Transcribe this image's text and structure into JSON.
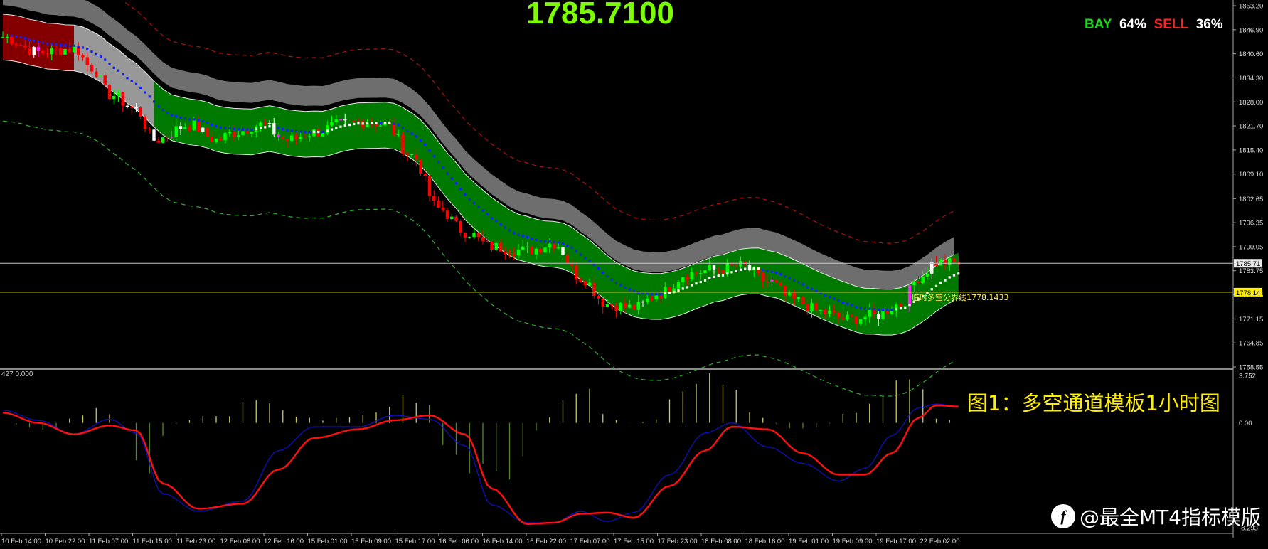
{
  "header": {
    "price": "1785.7100",
    "buy_label": "BAY",
    "buy_pct": "64%",
    "sell_label": "SELL",
    "sell_pct": "36%"
  },
  "caption": "图1：多空通道模板1小时图",
  "watermark": "@最全MT4指标模版",
  "watermark_logo": "f",
  "indicator_label": "427 0.000",
  "boundary_label": "临时多空分界线1778.1433",
  "price_tags": {
    "current": "1785.71",
    "boundary": "1778.14"
  },
  "colors": {
    "bull_candle": "#00ff00",
    "bear_candle": "#ff0000",
    "channel_fill": "#008000",
    "grey_band": "#7a7a7a",
    "dot_line_down": "#1020ff",
    "dot_line_up": "#ffffff",
    "macd_red": "#ff1010",
    "macd_blue": "#1010cc",
    "hist": "#c8c864"
  },
  "chart_data": [
    {
      "type": "candlestick",
      "ylim": [
        1758.55,
        1853.2
      ],
      "y_ticks": [
        "1853.20",
        "1846.90",
        "1840.60",
        "1834.30",
        "1828.00",
        "1821.70",
        "1815.40",
        "1809.10",
        "1802.65",
        "1796.35",
        "1790.05",
        "1783.75",
        "1777.45",
        "1771.15",
        "1764.85",
        "1758.55"
      ],
      "x_ticks": [
        "10 Feb 14:00",
        "10 Feb 22:00",
        "11 Feb 07:00",
        "11 Feb 15:00",
        "11 Feb 23:00",
        "12 Feb 08:00",
        "12 Feb 16:00",
        "15 Feb 01:00",
        "15 Feb 09:00",
        "15 Feb 17:00",
        "16 Feb 06:00",
        "16 Feb 14:00",
        "16 Feb 22:00",
        "17 Feb 07:00",
        "17 Feb 15:00",
        "17 Feb 23:00",
        "18 Feb 08:00",
        "18 Feb 16:00",
        "19 Feb 01:00",
        "19 Feb 09:00",
        "19 Feb 17:00",
        "22 Feb 02:00"
      ],
      "close_anchors": [
        [
          0,
          1845
        ],
        [
          8,
          1841
        ],
        [
          16,
          1842
        ],
        [
          20,
          1837
        ],
        [
          24,
          1830
        ],
        [
          30,
          1826
        ],
        [
          34,
          1818
        ],
        [
          42,
          1822
        ],
        [
          48,
          1818
        ],
        [
          52,
          1820
        ],
        [
          58,
          1822
        ],
        [
          64,
          1818
        ],
        [
          70,
          1820
        ],
        [
          76,
          1822
        ],
        [
          82,
          1823
        ],
        [
          86,
          1822
        ],
        [
          92,
          1814
        ],
        [
          98,
          1800
        ],
        [
          104,
          1794
        ],
        [
          110,
          1790
        ],
        [
          118,
          1789
        ],
        [
          124,
          1791
        ],
        [
          130,
          1782
        ],
        [
          136,
          1775
        ],
        [
          142,
          1774
        ],
        [
          148,
          1778
        ],
        [
          154,
          1783
        ],
        [
          160,
          1784
        ],
        [
          166,
          1785
        ],
        [
          172,
          1781
        ],
        [
          178,
          1776
        ],
        [
          184,
          1773
        ],
        [
          190,
          1771
        ],
        [
          196,
          1772
        ],
        [
          202,
          1775
        ],
        [
          206,
          1782
        ],
        [
          210,
          1786
        ],
        [
          215,
          1785.7
        ]
      ],
      "horizontal_lines": [
        {
          "name": "current-price",
          "value": 1785.71
        },
        {
          "name": "temporary-boundary",
          "value": 1778.14
        }
      ]
    },
    {
      "type": "line",
      "ylim": [
        -8.293,
        3.752
      ],
      "y_ticks": [
        "3.752",
        "0.00",
        "-8.293"
      ],
      "series": [
        {
          "anchors": [
            [
              0,
              0.8
            ],
            [
              8,
              0.0
            ],
            [
              16,
              -0.9
            ],
            [
              24,
              -0.2
            ],
            [
              30,
              -0.6
            ],
            [
              36,
              -4.8
            ],
            [
              44,
              -6.8
            ],
            [
              54,
              -6.4
            ],
            [
              62,
              -3.7
            ],
            [
              70,
              -1.2
            ],
            [
              80,
              -0.5
            ],
            [
              88,
              0.2
            ],
            [
              96,
              0.6
            ],
            [
              104,
              -0.9
            ],
            [
              110,
              -5.2
            ],
            [
              118,
              -8.0
            ],
            [
              124,
              -7.9
            ],
            [
              130,
              -7.2
            ],
            [
              136,
              -7.1
            ],
            [
              142,
              -7.5
            ],
            [
              150,
              -5.0
            ],
            [
              158,
              -2.2
            ],
            [
              164,
              -0.3
            ],
            [
              172,
              -0.5
            ],
            [
              180,
              -2.4
            ],
            [
              188,
              -4.1
            ],
            [
              194,
              -4.1
            ],
            [
              200,
              -2.4
            ],
            [
              206,
              0.4
            ],
            [
              210,
              1.4
            ],
            [
              215,
              1.3
            ]
          ]
        },
        {
          "anchors": [
            [
              0,
              1.0
            ],
            [
              8,
              0.2
            ],
            [
              16,
              -0.9
            ],
            [
              24,
              0.3
            ],
            [
              30,
              -0.8
            ],
            [
              36,
              -5.6
            ],
            [
              44,
              -7.0
            ],
            [
              54,
              -6.2
            ],
            [
              62,
              -2.2
            ],
            [
              70,
              -0.3
            ],
            [
              80,
              -0.3
            ],
            [
              88,
              0.6
            ],
            [
              96,
              0.3
            ],
            [
              104,
              -1.8
            ],
            [
              110,
              -6.5
            ],
            [
              118,
              -7.9
            ],
            [
              124,
              -7.9
            ],
            [
              130,
              -7.0
            ],
            [
              136,
              -7.8
            ],
            [
              142,
              -7.1
            ],
            [
              150,
              -4.1
            ],
            [
              158,
              -0.8
            ],
            [
              164,
              0.0
            ],
            [
              172,
              -1.9
            ],
            [
              180,
              -3.2
            ],
            [
              188,
              -4.6
            ],
            [
              194,
              -3.6
            ],
            [
              200,
              -1.0
            ],
            [
              206,
              1.2
            ],
            [
              210,
              1.5
            ],
            [
              215,
              1.3
            ]
          ]
        }
      ],
      "histogram_anchors": [
        [
          0,
          0
        ],
        [
          10,
          -0.6
        ],
        [
          16,
          0.4
        ],
        [
          22,
          1.1
        ],
        [
          26,
          0.3
        ],
        [
          32,
          -4.6
        ],
        [
          36,
          -1.2
        ],
        [
          40,
          0.1
        ],
        [
          46,
          0.5
        ],
        [
          50,
          0.5
        ],
        [
          56,
          2.1
        ],
        [
          60,
          1.5
        ],
        [
          68,
          0.4
        ],
        [
          72,
          0.2
        ],
        [
          78,
          0.5
        ],
        [
          84,
          0.9
        ],
        [
          90,
          2.1
        ],
        [
          96,
          1.3
        ],
        [
          100,
          -2.1
        ],
        [
          106,
          -3.6
        ],
        [
          114,
          -4.0
        ],
        [
          120,
          -0.6
        ],
        [
          126,
          1.6
        ],
        [
          132,
          2.5
        ],
        [
          136,
          0.5
        ],
        [
          140,
          0
        ],
        [
          146,
          0.1
        ],
        [
          152,
          2.3
        ],
        [
          158,
          3.7
        ],
        [
          164,
          2.6
        ],
        [
          170,
          0.4
        ],
        [
          178,
          -0.5
        ],
        [
          184,
          -0.3
        ],
        [
          190,
          0.7
        ],
        [
          196,
          1.4
        ],
        [
          202,
          3.6
        ],
        [
          206,
          3.2
        ],
        [
          210,
          0.3
        ],
        [
          215,
          0.2
        ]
      ]
    }
  ]
}
